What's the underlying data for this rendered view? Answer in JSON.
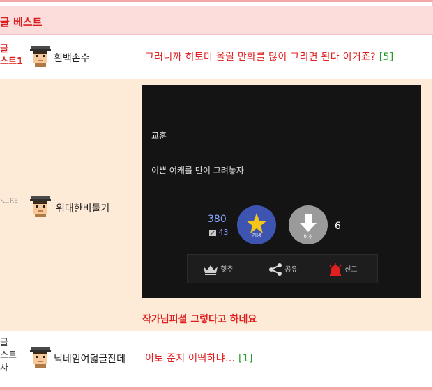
{
  "header": {
    "title": "글 베스트"
  },
  "rows": [
    {
      "rank_lines": [
        "글",
        "스트1"
      ],
      "nickname": "흰백손수",
      "comment": "그러니까 히토미 올릴 만화를 많이 그리면 된다 이거죠?",
      "reply_count": "[5]"
    },
    {
      "re_mark": "RE",
      "nickname": "위대한비둘기",
      "comic": {
        "line1": "교훈",
        "line2": "이쁜 여캐를 만이 그려놓자",
        "up_count": "380",
        "up_sub": "43",
        "up_label": "개념",
        "down_label": "비추",
        "down_count": "6",
        "actions": [
          "힛추",
          "공유",
          "신고"
        ]
      },
      "caption": "작가님피셜 그렇다고 하네요"
    },
    {
      "rank_lines": [
        "글",
        "스트",
        "자"
      ],
      "nickname": "닉네임여덟글잔데",
      "comment": "이토 준지 어떡하냐...",
      "reply_count": "[1]"
    }
  ],
  "colors": {
    "accent_red": "#e02020",
    "header_bg": "#fddcdc",
    "reply_row_bg": "#fdebd8",
    "count_green": "#2a9a2a",
    "upvote_blue": "#3d55b0"
  },
  "icons": [
    "avatar-icon",
    "star-icon",
    "down-arrow-icon",
    "crown-icon",
    "share-icon",
    "siren-icon",
    "reply-arrow-icon"
  ]
}
